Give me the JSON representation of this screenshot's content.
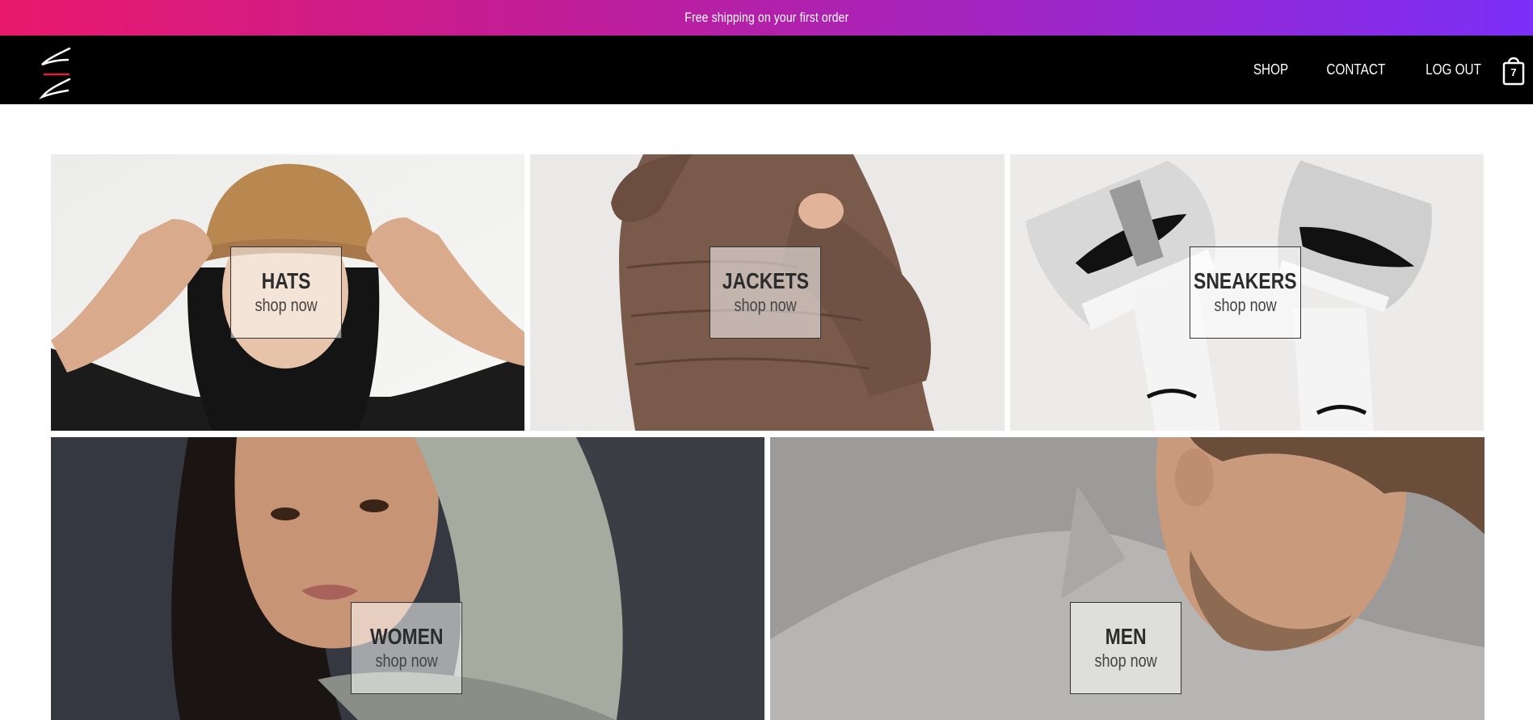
{
  "banner": {
    "text": "Free shipping on your first order"
  },
  "nav": {
    "links": [
      {
        "label": "SHOP"
      },
      {
        "label": "CONTACT"
      },
      {
        "label": "LOG OUT"
      }
    ],
    "cart_count": "7"
  },
  "categories": [
    {
      "title": "HATS",
      "cta": "shop now"
    },
    {
      "title": "JACKETS",
      "cta": "shop now"
    },
    {
      "title": "SNEAKERS",
      "cta": "shop now"
    },
    {
      "title": "WOMEN",
      "cta": "shop now"
    },
    {
      "title": "MEN",
      "cta": "shop now"
    }
  ],
  "colors": {
    "banner_gradient_start": "#e8196b",
    "banner_gradient_end": "#7b2ff7",
    "nav_background": "#000000"
  }
}
